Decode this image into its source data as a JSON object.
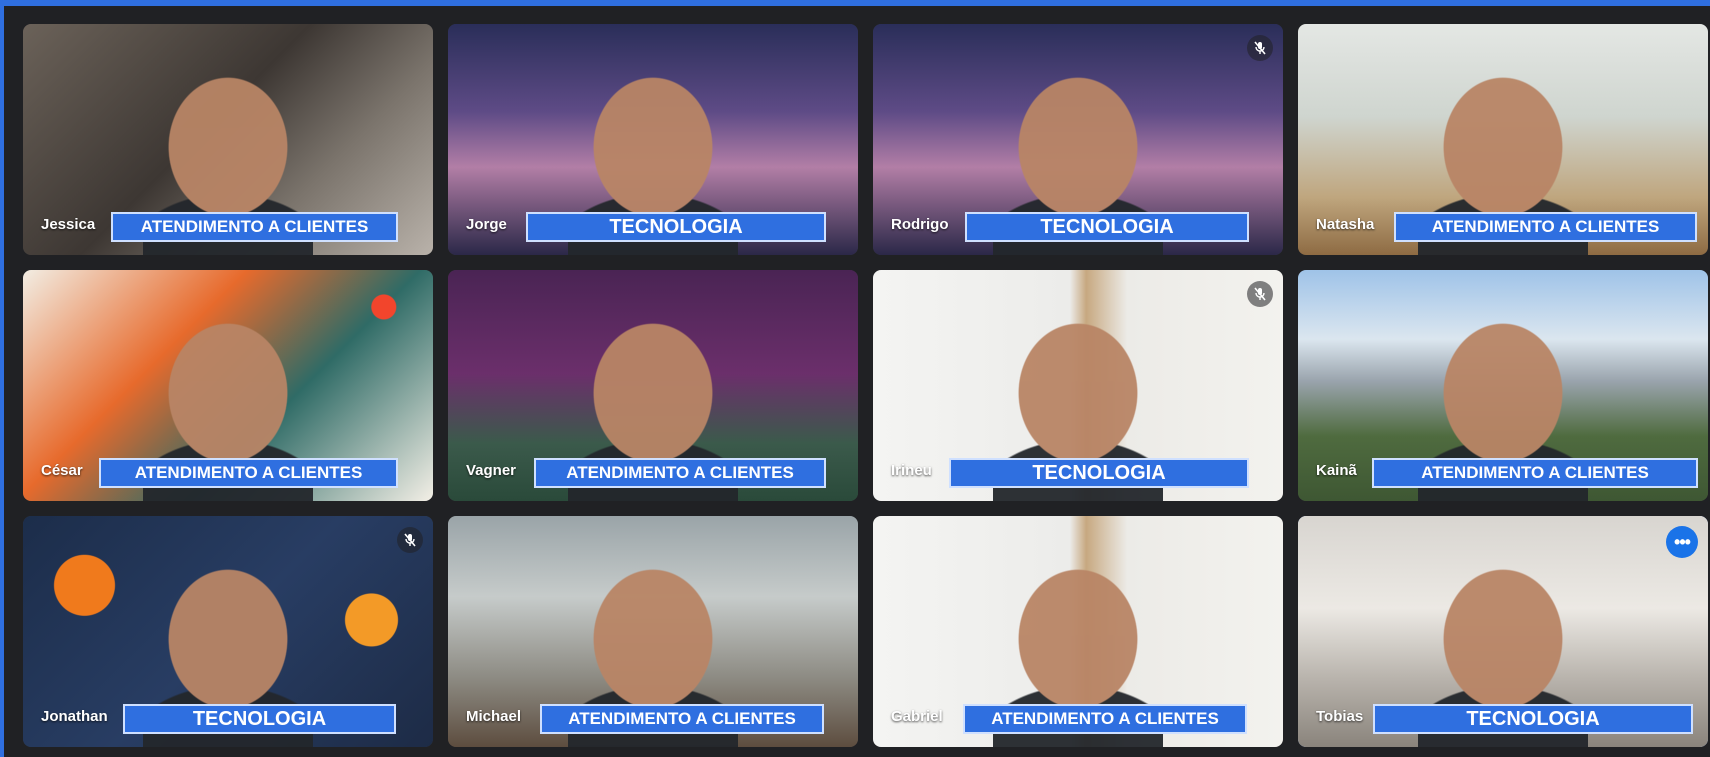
{
  "participants": [
    {
      "name": "Jessica",
      "team": "ATENDIMENTO A CLIENTES"
    },
    {
      "name": "Jorge",
      "team": "TECNOLOGIA"
    },
    {
      "name": "Rodrigo",
      "team": "TECNOLOGIA",
      "muted_icon": "mic-off-icon"
    },
    {
      "name": "Natasha",
      "team": "ATENDIMENTO A CLIENTES"
    },
    {
      "name": "César",
      "team": "ATENDIMENTO A CLIENTES"
    },
    {
      "name": "Vagner",
      "team": "ATENDIMENTO A CLIENTES"
    },
    {
      "name": "Irineu",
      "team": "TECNOLOGIA",
      "muted_icon": "mic-off-icon"
    },
    {
      "name": "Kainã",
      "team": "ATENDIMENTO A CLIENTES"
    },
    {
      "name": "Jonathan",
      "team": "TECNOLOGIA",
      "muted_icon": "mic-off-icon"
    },
    {
      "name": "Michael",
      "team": "ATENDIMENTO A CLIENTES"
    },
    {
      "name": "Gabriel",
      "team": "ATENDIMENTO A CLIENTES"
    },
    {
      "name": "Tobias",
      "team": "TECNOLOGIA",
      "options_icon": "more-options-icon",
      "active": true
    }
  ],
  "colors": {
    "outer_frame": "#2f6fe0",
    "background": "#202124",
    "label_fill": "#2f6fe0",
    "label_border": "#cfe0ff",
    "active_border": "#8ab4f8"
  }
}
